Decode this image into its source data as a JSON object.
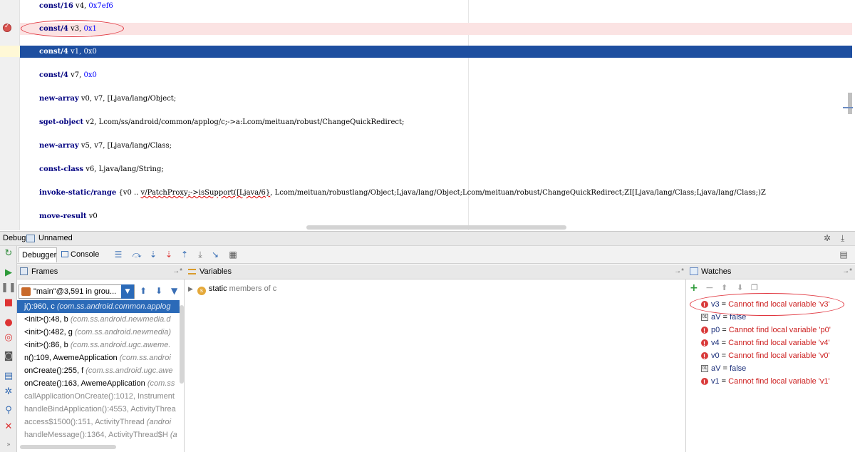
{
  "editor": {
    "lines": [
      {
        "op": "const/16",
        "args": " v4, ",
        "num": "0x7ef6"
      },
      {
        "op": "const/4",
        "args": " v3, ",
        "num": "0x1"
      },
      {
        "op": "const/4",
        "args": " v1, ",
        "num": "0x0"
      },
      {
        "op": "const/4",
        "args": " v7, ",
        "num": "0x0"
      },
      {
        "op": "new-array",
        "args": " v0, v7, [Ljava/lang/Object;",
        "num": ""
      },
      {
        "op": "sget-object",
        "args": " v2, Lcom/ss/android/common/applog/c;->a:Lcom/meituan/robust/ChangeQuickRedirect;",
        "num": ""
      },
      {
        "op": "new-array",
        "args": " v5, v7, [Ljava/lang/Class;",
        "num": ""
      },
      {
        "op": "const-class",
        "args": " v6, Ljava/lang/String;",
        "num": ""
      },
      {
        "op": "invoke-static/range",
        "args": " {v0 .. ",
        "num": ""
      },
      {
        "op": "move-result",
        "args": " v0",
        "num": ""
      }
    ],
    "invoke_err": "v/PatchProxy;->isSupport([Ljava/6}",
    "invoke_tail": ", Lcom/meituan/robustlang/Object;Ljava/lang/Object;Lcom/meituan/robust/ChangeQuickRedirect;ZI[Ljava/lang/Class;Ljava/lang/Class;)Z"
  },
  "debug": {
    "title": "Debug",
    "config_name": "Unnamed",
    "tabs": {
      "debugger": "Debugger",
      "console": "Console"
    },
    "console_arrow": "→*"
  },
  "frames": {
    "header": "Frames",
    "thread": "\"main\"@3,591 in grou...",
    "items": [
      {
        "method": "j():960, c ",
        "loc": "(com.ss.android.common.applog"
      },
      {
        "method": "<init>():48, b ",
        "loc": "(com.ss.android.newmedia.d"
      },
      {
        "method": "<init>():482, g ",
        "loc": "(com.ss.android.newmedia)"
      },
      {
        "method": "<init>():86, b ",
        "loc": "(com.ss.android.ugc.aweme."
      },
      {
        "method": "n():109, AwemeApplication ",
        "loc": "(com.ss.androi"
      },
      {
        "method": "onCreate():255, f ",
        "loc": "(com.ss.android.ugc.awe"
      },
      {
        "method": "onCreate():163, AwemeApplication ",
        "loc": "(com.ss"
      },
      {
        "method": "callApplicationOnCreate():1012, Instrument",
        "loc": ""
      },
      {
        "method": "handleBindApplication():4553, ActivityThrea",
        "loc": ""
      },
      {
        "method": "access$1500():151, ActivityThread ",
        "loc": "(androi"
      },
      {
        "method": "handleMessage():1364, ActivityThread$H ",
        "loc": "(a"
      }
    ]
  },
  "variables": {
    "header": "Variables",
    "row_label": "static",
    "row_value": " members of c"
  },
  "watches": {
    "header": "Watches",
    "items": [
      {
        "kind": "err",
        "name": "v3",
        "value": "Cannot find local variable 'v3'"
      },
      {
        "kind": "bool",
        "name": "aV",
        "value": "false"
      },
      {
        "kind": "err",
        "name": "p0",
        "value": "Cannot find local variable 'p0'"
      },
      {
        "kind": "err",
        "name": "v4",
        "value": "Cannot find local variable 'v4'"
      },
      {
        "kind": "err",
        "name": "v0",
        "value": "Cannot find local variable 'v0'"
      },
      {
        "kind": "bool",
        "name": "aV",
        "value": "false"
      },
      {
        "kind": "err",
        "name": "v1",
        "value": "Cannot find local variable 'v1'"
      }
    ]
  },
  "colors": {
    "selection": "#2b6ab8",
    "current_line": "#1e4fa0",
    "breakpoint_line": "#fbe3e3",
    "error_text": "#cc1f1f",
    "annotation": "#e0343d"
  },
  "icons": [
    "breakpoint-icon",
    "resume-icon",
    "pause-icon",
    "stop-icon",
    "step-over-icon",
    "step-into-icon",
    "step-out-icon",
    "settings-icon",
    "add-icon",
    "remove-icon"
  ]
}
